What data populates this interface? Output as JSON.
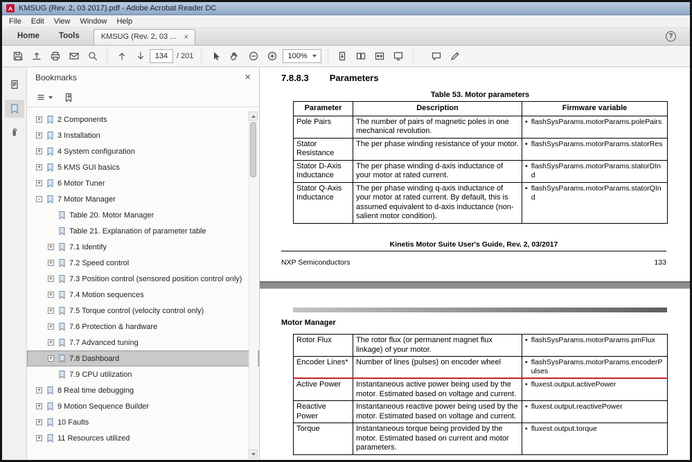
{
  "titlebar": {
    "title": "KMSUG (Rev. 2, 03 2017).pdf - Adobe Acrobat Reader DC"
  },
  "menubar": {
    "items": [
      {
        "label": "File"
      },
      {
        "label": "Edit"
      },
      {
        "label": "View"
      },
      {
        "label": "Window"
      },
      {
        "label": "Help"
      }
    ]
  },
  "tabbar": {
    "tabs": [
      {
        "label": "Home"
      },
      {
        "label": "Tools"
      }
    ],
    "doc_tab_label": "KMSUG (Rev. 2, 03 ...",
    "doc_tab_close": "×",
    "help_glyph": "?"
  },
  "toolbar": {
    "page_current": "134",
    "page_total_label": "/ 201",
    "zoom_value": "100%"
  },
  "sidebar": {
    "title": "Bookmarks",
    "close_glyph": "×",
    "items": [
      {
        "label": "2 Components",
        "level": 0,
        "expander": "+"
      },
      {
        "label": "3 Installation",
        "level": 0,
        "expander": "+"
      },
      {
        "label": "4 System configuration",
        "level": 0,
        "expander": "+"
      },
      {
        "label": "5 KMS GUI basics",
        "level": 0,
        "expander": "+"
      },
      {
        "label": "6 Motor Tuner",
        "level": 0,
        "expander": "+"
      },
      {
        "label": "7 Motor Manager",
        "level": 0,
        "expander": "-"
      },
      {
        "label": "Table 20. Motor Manager",
        "level": 1,
        "expander": ""
      },
      {
        "label": "Table 21. Explanation of parameter table",
        "level": 1,
        "expander": ""
      },
      {
        "label": "7.1 Identify",
        "level": 1,
        "expander": "+"
      },
      {
        "label": "7.2 Speed control",
        "level": 1,
        "expander": "+"
      },
      {
        "label": "7.3 Position control (sensored position control only)",
        "level": 1,
        "expander": "+"
      },
      {
        "label": "7.4 Motion sequences",
        "level": 1,
        "expander": "+"
      },
      {
        "label": "7.5 Torque control (velocity control only)",
        "level": 1,
        "expander": "+"
      },
      {
        "label": "7.6 Protection & hardware",
        "level": 1,
        "expander": "+"
      },
      {
        "label": "7.7 Advanced tuning",
        "level": 1,
        "expander": "+"
      },
      {
        "label": "7.8 Dashboard",
        "level": 1,
        "expander": "+",
        "selected": true
      },
      {
        "label": "7.9 CPU utilization",
        "level": 1,
        "expander": ""
      },
      {
        "label": "8 Real time debugging",
        "level": 0,
        "expander": "+"
      },
      {
        "label": "9 Motion Sequence Builder",
        "level": 0,
        "expander": "+"
      },
      {
        "label": "10 Faults",
        "level": 0,
        "expander": "+"
      },
      {
        "label": "11 Resources utilized",
        "level": 0,
        "expander": "+"
      }
    ]
  },
  "document": {
    "bullet": "•",
    "page1": {
      "section_number": "7.8.8.3",
      "section_title": "Parameters",
      "table_caption": "Table 53. Motor parameters",
      "col_headers": [
        "Parameter",
        "Description",
        "Firmware variable"
      ],
      "rows": [
        {
          "param": "Pole Pairs",
          "desc": "The number of pairs of magnetic poles in one mechanical revolution.",
          "fw": "flashSysParams.motorParams.polePairs"
        },
        {
          "param": "Stator Resistance",
          "desc": "The per phase winding resistance of your motor.",
          "fw": "flashSysParams.motorParams.statorRes"
        },
        {
          "param": "Stator D-Axis Inductance",
          "desc": "The per phase winding d-axis inductance of your motor at rated current.",
          "fw": "flashSysParams.motorParams.statorDInd"
        },
        {
          "param": "Stator Q-Axis Inductance",
          "desc": "The per phase winding q-axis inductance of your motor at rated current. By default, this is assumed equivalent to d-axis inductance (non-salient motor condition).",
          "fw": "flashSysParams.motorParams.statorQInd"
        }
      ],
      "footer_center": "Kinetis Motor Suite User's Guide, Rev. 2, 03/2017",
      "footer_left": "NXP Semiconductors",
      "footer_right": "133"
    },
    "page2": {
      "running_header": "Motor Manager",
      "rows": [
        {
          "param": "Rotor Flux",
          "desc": "The rotor flux (or permanent magnet flux linkage) of your motor.",
          "fw": "flashSysParams.motorParams.pmFlux"
        },
        {
          "param": "Encoder Lines*",
          "desc": "Number of lines (pulses) on encoder wheel",
          "fw": "flashSysParams.motorParams.encoderPulses",
          "red": true
        },
        {
          "param": "Active Power",
          "desc": "Instantaneous active power being used by the motor. Estimated based on voltage and current.",
          "fw": "fluxest.output.activePower"
        },
        {
          "param": "Reactive Power",
          "desc": "Instantaneous reactive power being used by the motor. Estimated based on voltage and current.",
          "fw": "fluxest.output.reactivePower"
        },
        {
          "param": "Torque",
          "desc": "Instantaneous torque being provided by the motor. Estimated based on current and motor parameters.",
          "fw": "fluxest.output.torque"
        }
      ]
    }
  }
}
